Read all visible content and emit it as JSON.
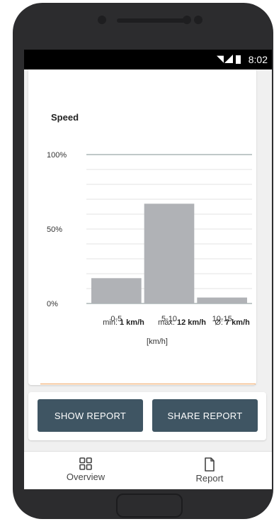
{
  "status_bar": {
    "time": "8:02"
  },
  "speed_card": {
    "title": "Speed",
    "stats": {
      "min_label": "min:",
      "min_value": "1 km/h",
      "max_label": "max:",
      "max_value": "12 km/h",
      "avg_label": "Ø:",
      "avg_value": "7 km/h"
    },
    "unit": "[km/h]"
  },
  "chart_data": {
    "type": "bar",
    "categories": [
      "0-5",
      "5-10",
      "10-15"
    ],
    "values": [
      17,
      67,
      4
    ],
    "yticks": [
      "0%",
      "50%",
      "100%"
    ],
    "ylim": [
      0,
      100
    ],
    "grid": true,
    "bar_color": "#b0b2b6"
  },
  "buttons": {
    "show_report": "SHOW REPORT",
    "share_report": "SHARE REPORT",
    "color": "#3f5563"
  },
  "nav": {
    "overview": "Overview",
    "report": "Report"
  }
}
